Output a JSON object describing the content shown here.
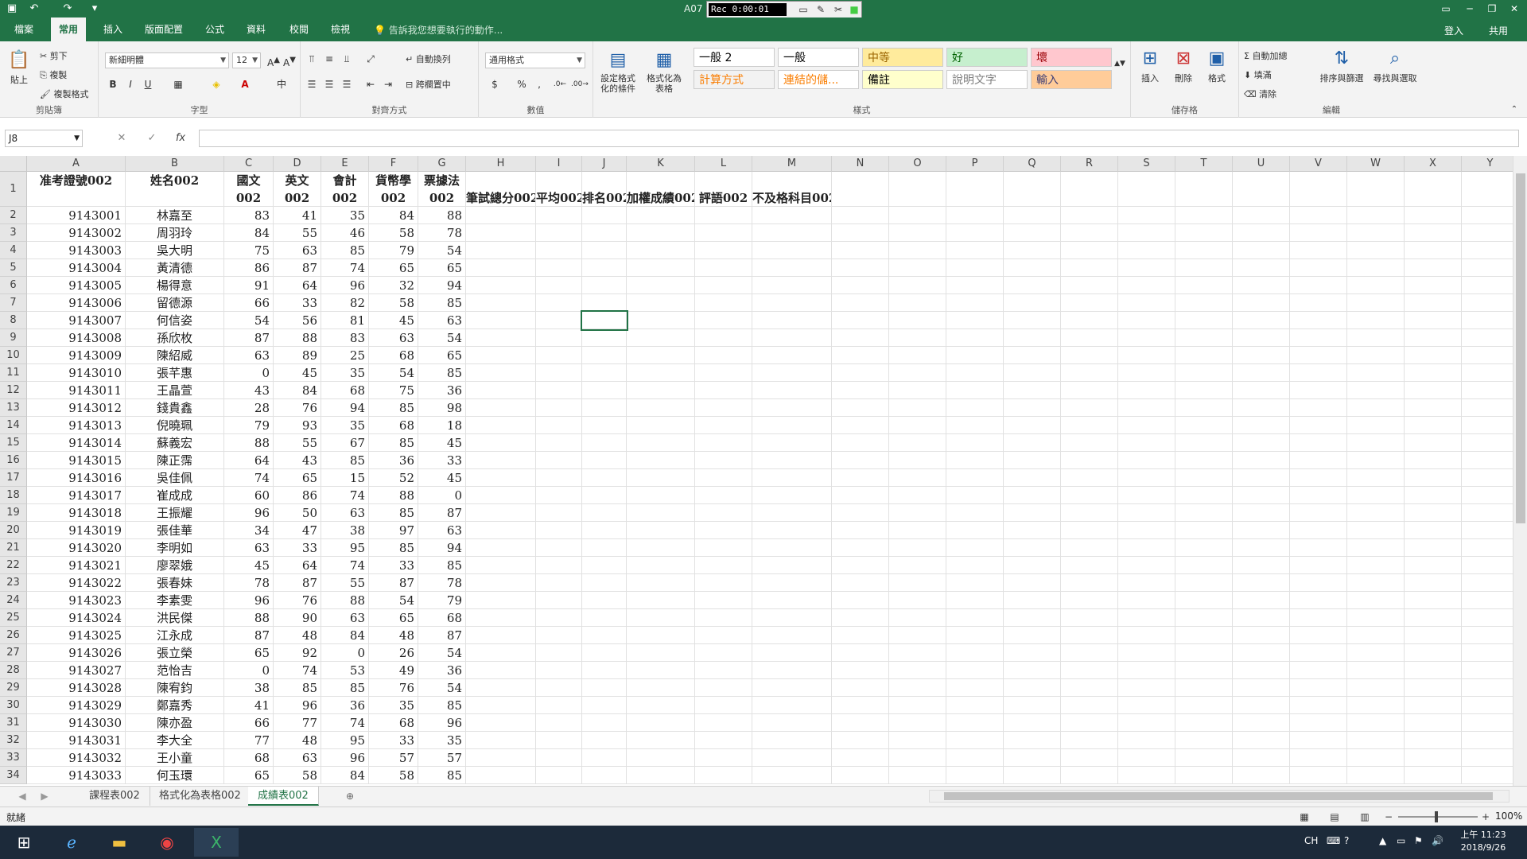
{
  "window": {
    "title": "A07",
    "recorder": {
      "label": "Rec 0:00:01"
    },
    "signin": "登入",
    "share": "共用"
  },
  "tabs": [
    "檔案",
    "常用",
    "插入",
    "版面配置",
    "公式",
    "資料",
    "校閱",
    "檢視"
  ],
  "active_tab": "常用",
  "tellme": "告訴我您想要執行的動作...",
  "ribbon": {
    "clipboard": {
      "label": "剪貼簿",
      "paste": "貼上",
      "cut": "剪下",
      "copy": "複製",
      "format_painter": "複製格式"
    },
    "font": {
      "label": "字型",
      "name": "新細明體",
      "size": "12"
    },
    "alignment": {
      "label": "對齊方式",
      "wrap": "自動換列",
      "merge": "跨欄置中"
    },
    "number": {
      "label": "數值",
      "format": "通用格式"
    },
    "styles": {
      "label": "樣式",
      "conditional": "設定格式化的條件",
      "as_table": "格式化為表格",
      "cells": [
        {
          "text": "一般 2",
          "bg": "#ffffff",
          "fg": "#000000"
        },
        {
          "text": "一般",
          "bg": "#ffffff",
          "fg": "#000000"
        },
        {
          "text": "中等",
          "bg": "#ffeb9c",
          "fg": "#9c6500"
        },
        {
          "text": "好",
          "bg": "#c6efce",
          "fg": "#006100"
        },
        {
          "text": "壞",
          "bg": "#ffc7ce",
          "fg": "#9c0006"
        },
        {
          "text": "計算方式",
          "bg": "#f2f2f2",
          "fg": "#fa7d00"
        },
        {
          "text": "連結的儲...",
          "bg": "#ffffff",
          "fg": "#fa7d00"
        },
        {
          "text": "備註",
          "bg": "#ffffcc",
          "fg": "#000000"
        },
        {
          "text": "說明文字",
          "bg": "#ffffff",
          "fg": "#7f7f7f"
        },
        {
          "text": "輸入",
          "bg": "#ffcc99",
          "fg": "#3f3f76"
        }
      ]
    },
    "cells": {
      "label": "儲存格",
      "insert": "插入",
      "delete": "刪除",
      "format": "格式"
    },
    "editing": {
      "label": "編輯",
      "autosum": "自動加總",
      "fill": "填滿",
      "clear": "清除",
      "sort": "排序與篩選",
      "find": "尋找與選取"
    }
  },
  "formula_bar": {
    "name_box": "J8",
    "formula": ""
  },
  "columns": [
    "A",
    "B",
    "C",
    "D",
    "E",
    "F",
    "G",
    "H",
    "I",
    "J",
    "K",
    "L",
    "M",
    "N",
    "O",
    "P",
    "Q",
    "R",
    "S",
    "T",
    "U",
    "V",
    "W",
    "X",
    "Y"
  ],
  "headers": {
    "A": "准考證號002",
    "B": "姓名002",
    "C": "國文002",
    "D": "英文002",
    "E": "會計002",
    "F": "貨幣學002",
    "G": "票據法002",
    "H": "筆試總分002",
    "I": "平均002",
    "J": "排名002",
    "K": "加權成績002",
    "L": "評語002",
    "M": "不及格科目002"
  },
  "rows": [
    [
      "9143001",
      "林嘉至",
      83,
      41,
      35,
      84,
      88
    ],
    [
      "9143002",
      "周羽玲",
      84,
      55,
      46,
      58,
      78
    ],
    [
      "9143003",
      "吳大明",
      75,
      63,
      85,
      79,
      54
    ],
    [
      "9143004",
      "黃清德",
      86,
      87,
      74,
      65,
      65
    ],
    [
      "9143005",
      "楊得意",
      91,
      64,
      96,
      32,
      94
    ],
    [
      "9143006",
      "留德源",
      66,
      33,
      82,
      58,
      85
    ],
    [
      "9143007",
      "何信姿",
      54,
      56,
      81,
      45,
      63
    ],
    [
      "9143008",
      "孫欣枚",
      87,
      88,
      83,
      63,
      54
    ],
    [
      "9143009",
      "陳紹威",
      63,
      89,
      25,
      68,
      65
    ],
    [
      "9143010",
      "張芊惠",
      0,
      45,
      35,
      54,
      85
    ],
    [
      "9143011",
      "王晶萱",
      43,
      84,
      68,
      75,
      36
    ],
    [
      "9143012",
      "錢貴鑫",
      28,
      76,
      94,
      85,
      98
    ],
    [
      "9143013",
      "倪曉珮",
      79,
      93,
      35,
      68,
      18
    ],
    [
      "9143014",
      "蘇義宏",
      88,
      55,
      67,
      85,
      45
    ],
    [
      "9143015",
      "陳正霈",
      64,
      43,
      85,
      36,
      33
    ],
    [
      "9143016",
      "吳佳佩",
      74,
      65,
      15,
      52,
      45
    ],
    [
      "9143017",
      "崔成成",
      60,
      86,
      74,
      88,
      0
    ],
    [
      "9143018",
      "王振耀",
      96,
      50,
      63,
      85,
      87
    ],
    [
      "9143019",
      "張佳華",
      34,
      47,
      38,
      97,
      63
    ],
    [
      "9143020",
      "李明如",
      63,
      33,
      95,
      85,
      94
    ],
    [
      "9143021",
      "廖翠娥",
      45,
      64,
      74,
      33,
      85
    ],
    [
      "9143022",
      "張春妹",
      78,
      87,
      55,
      87,
      78
    ],
    [
      "9143023",
      "李素雯",
      96,
      76,
      88,
      54,
      79
    ],
    [
      "9143024",
      "洪民傑",
      88,
      90,
      63,
      65,
      68
    ],
    [
      "9143025",
      "江永成",
      87,
      48,
      84,
      48,
      87
    ],
    [
      "9143026",
      "張立榮",
      65,
      92,
      0,
      26,
      54
    ],
    [
      "9143027",
      "范怡吉",
      0,
      74,
      53,
      49,
      36
    ],
    [
      "9143028",
      "陳宥鈞",
      38,
      85,
      85,
      76,
      54
    ],
    [
      "9143029",
      "鄭嘉秀",
      41,
      96,
      36,
      35,
      85
    ],
    [
      "9143030",
      "陳亦盈",
      66,
      77,
      74,
      68,
      96
    ],
    [
      "9143031",
      "李大全",
      77,
      48,
      95,
      33,
      35
    ],
    [
      "9143032",
      "王小童",
      68,
      63,
      96,
      57,
      57
    ],
    [
      "9143033",
      "何玉環",
      65,
      58,
      84,
      58,
      85
    ]
  ],
  "sheets": [
    "課程表002",
    "格式化為表格002",
    "成績表002"
  ],
  "active_sheet": "成績表002",
  "status": {
    "ready": "就緒",
    "zoom": "100%"
  },
  "clock": {
    "time": "上午 11:23",
    "date": "2018/9/26",
    "lang": "CH"
  }
}
